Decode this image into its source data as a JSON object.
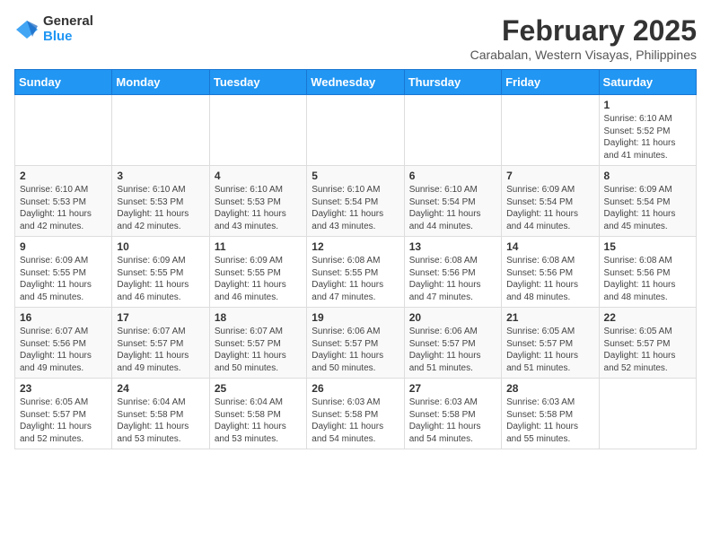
{
  "logo": {
    "general": "General",
    "blue": "Blue"
  },
  "title": "February 2025",
  "subtitle": "Carabalan, Western Visayas, Philippines",
  "days_of_week": [
    "Sunday",
    "Monday",
    "Tuesday",
    "Wednesday",
    "Thursday",
    "Friday",
    "Saturday"
  ],
  "weeks": [
    [
      {
        "day": "",
        "info": ""
      },
      {
        "day": "",
        "info": ""
      },
      {
        "day": "",
        "info": ""
      },
      {
        "day": "",
        "info": ""
      },
      {
        "day": "",
        "info": ""
      },
      {
        "day": "",
        "info": ""
      },
      {
        "day": "1",
        "info": "Sunrise: 6:10 AM\nSunset: 5:52 PM\nDaylight: 11 hours and 41 minutes."
      }
    ],
    [
      {
        "day": "2",
        "info": "Sunrise: 6:10 AM\nSunset: 5:53 PM\nDaylight: 11 hours and 42 minutes."
      },
      {
        "day": "3",
        "info": "Sunrise: 6:10 AM\nSunset: 5:53 PM\nDaylight: 11 hours and 42 minutes."
      },
      {
        "day": "4",
        "info": "Sunrise: 6:10 AM\nSunset: 5:53 PM\nDaylight: 11 hours and 43 minutes."
      },
      {
        "day": "5",
        "info": "Sunrise: 6:10 AM\nSunset: 5:54 PM\nDaylight: 11 hours and 43 minutes."
      },
      {
        "day": "6",
        "info": "Sunrise: 6:10 AM\nSunset: 5:54 PM\nDaylight: 11 hours and 44 minutes."
      },
      {
        "day": "7",
        "info": "Sunrise: 6:09 AM\nSunset: 5:54 PM\nDaylight: 11 hours and 44 minutes."
      },
      {
        "day": "8",
        "info": "Sunrise: 6:09 AM\nSunset: 5:54 PM\nDaylight: 11 hours and 45 minutes."
      }
    ],
    [
      {
        "day": "9",
        "info": "Sunrise: 6:09 AM\nSunset: 5:55 PM\nDaylight: 11 hours and 45 minutes."
      },
      {
        "day": "10",
        "info": "Sunrise: 6:09 AM\nSunset: 5:55 PM\nDaylight: 11 hours and 46 minutes."
      },
      {
        "day": "11",
        "info": "Sunrise: 6:09 AM\nSunset: 5:55 PM\nDaylight: 11 hours and 46 minutes."
      },
      {
        "day": "12",
        "info": "Sunrise: 6:08 AM\nSunset: 5:55 PM\nDaylight: 11 hours and 47 minutes."
      },
      {
        "day": "13",
        "info": "Sunrise: 6:08 AM\nSunset: 5:56 PM\nDaylight: 11 hours and 47 minutes."
      },
      {
        "day": "14",
        "info": "Sunrise: 6:08 AM\nSunset: 5:56 PM\nDaylight: 11 hours and 48 minutes."
      },
      {
        "day": "15",
        "info": "Sunrise: 6:08 AM\nSunset: 5:56 PM\nDaylight: 11 hours and 48 minutes."
      }
    ],
    [
      {
        "day": "16",
        "info": "Sunrise: 6:07 AM\nSunset: 5:56 PM\nDaylight: 11 hours and 49 minutes."
      },
      {
        "day": "17",
        "info": "Sunrise: 6:07 AM\nSunset: 5:57 PM\nDaylight: 11 hours and 49 minutes."
      },
      {
        "day": "18",
        "info": "Sunrise: 6:07 AM\nSunset: 5:57 PM\nDaylight: 11 hours and 50 minutes."
      },
      {
        "day": "19",
        "info": "Sunrise: 6:06 AM\nSunset: 5:57 PM\nDaylight: 11 hours and 50 minutes."
      },
      {
        "day": "20",
        "info": "Sunrise: 6:06 AM\nSunset: 5:57 PM\nDaylight: 11 hours and 51 minutes."
      },
      {
        "day": "21",
        "info": "Sunrise: 6:05 AM\nSunset: 5:57 PM\nDaylight: 11 hours and 51 minutes."
      },
      {
        "day": "22",
        "info": "Sunrise: 6:05 AM\nSunset: 5:57 PM\nDaylight: 11 hours and 52 minutes."
      }
    ],
    [
      {
        "day": "23",
        "info": "Sunrise: 6:05 AM\nSunset: 5:57 PM\nDaylight: 11 hours and 52 minutes."
      },
      {
        "day": "24",
        "info": "Sunrise: 6:04 AM\nSunset: 5:58 PM\nDaylight: 11 hours and 53 minutes."
      },
      {
        "day": "25",
        "info": "Sunrise: 6:04 AM\nSunset: 5:58 PM\nDaylight: 11 hours and 53 minutes."
      },
      {
        "day": "26",
        "info": "Sunrise: 6:03 AM\nSunset: 5:58 PM\nDaylight: 11 hours and 54 minutes."
      },
      {
        "day": "27",
        "info": "Sunrise: 6:03 AM\nSunset: 5:58 PM\nDaylight: 11 hours and 54 minutes."
      },
      {
        "day": "28",
        "info": "Sunrise: 6:03 AM\nSunset: 5:58 PM\nDaylight: 11 hours and 55 minutes."
      },
      {
        "day": "",
        "info": ""
      }
    ]
  ]
}
